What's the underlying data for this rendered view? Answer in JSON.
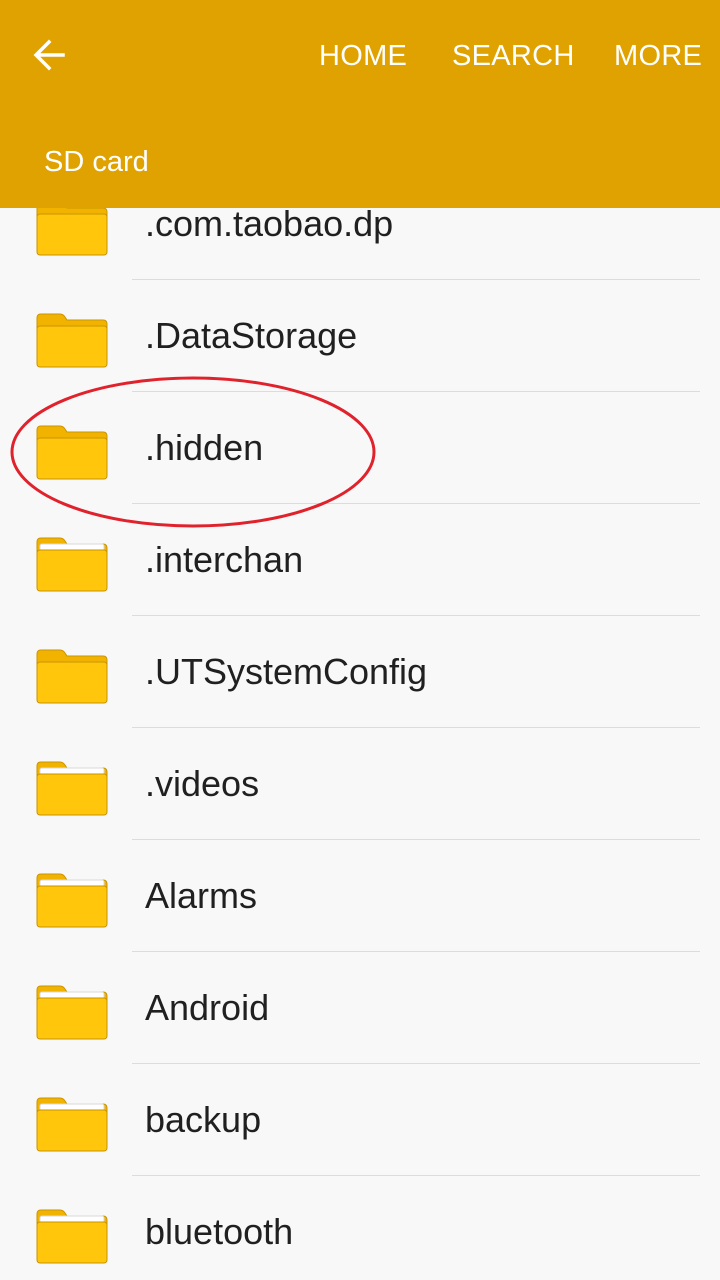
{
  "header": {
    "actions": {
      "home": "HOME",
      "search": "SEARCH",
      "more": "MORE"
    },
    "title": "SD card"
  },
  "folders": [
    {
      "name": ".com.taobao.dp",
      "has_content": false
    },
    {
      "name": ".DataStorage",
      "has_content": false
    },
    {
      "name": ".hidden",
      "has_content": false
    },
    {
      "name": ".interchan",
      "has_content": true
    },
    {
      "name": ".UTSystemConfig",
      "has_content": false
    },
    {
      "name": ".videos",
      "has_content": true
    },
    {
      "name": "Alarms",
      "has_content": true
    },
    {
      "name": "Android",
      "has_content": true
    },
    {
      "name": "backup",
      "has_content": true
    },
    {
      "name": "bluetooth",
      "has_content": true
    }
  ],
  "annotation": {
    "target": ".hidden",
    "color": "#e0222c"
  },
  "colors": {
    "accent": "#e0a200",
    "folder": "#ffc60b",
    "folder_tab": "#f2b300"
  }
}
